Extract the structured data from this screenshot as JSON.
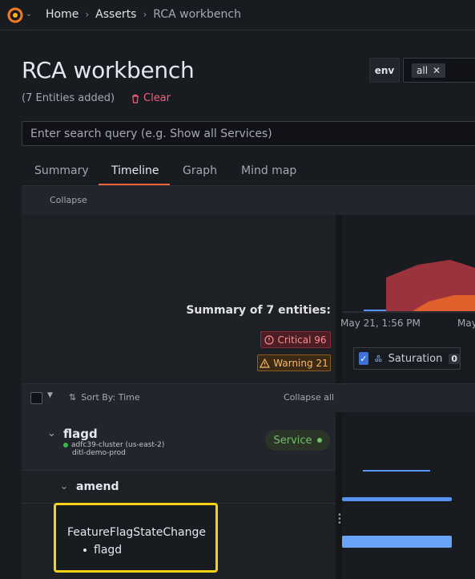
{
  "breadcrumb": {
    "home": "Home",
    "asserts": "Asserts",
    "current": "RCA workbench"
  },
  "page": {
    "title": "RCA workbench",
    "entities_added": "(7 Entities added)",
    "clear_label": "Clear"
  },
  "env_filter": {
    "label": "env",
    "value": "all"
  },
  "search": {
    "placeholder": "Enter search query (e.g. Show all Services)"
  },
  "tabs": [
    {
      "label": "Summary"
    },
    {
      "label": "Timeline",
      "active": true
    },
    {
      "label": "Graph"
    },
    {
      "label": "Mind map"
    }
  ],
  "timeline": {
    "collapse_label": "Collapse",
    "summary_title": "Summary of 7 entities:",
    "critical_label": "Critical 96",
    "warning_label": "Warning 21",
    "axis_start": "May 21, 1:56 PM",
    "axis_next": "May",
    "saturation_label": "Saturation",
    "saturation_count": "0"
  },
  "list": {
    "sort_label": "Sort By: Time",
    "collapse_all_label": "Collapse all",
    "entity": {
      "name": "flagd",
      "cluster": "adfc39-cluster (us-east-2)",
      "env": "ditl-demo-prod",
      "type_badge": "Service"
    },
    "group": {
      "name": "amend"
    },
    "event": {
      "title": "FeatureFlagStateChange",
      "item": "flagd"
    }
  },
  "colors": {
    "accent": "#f0643c",
    "critical": "#c4314b",
    "warning": "#f57c30",
    "series_blue": "#5794f2",
    "highlight": "#f5d218"
  }
}
